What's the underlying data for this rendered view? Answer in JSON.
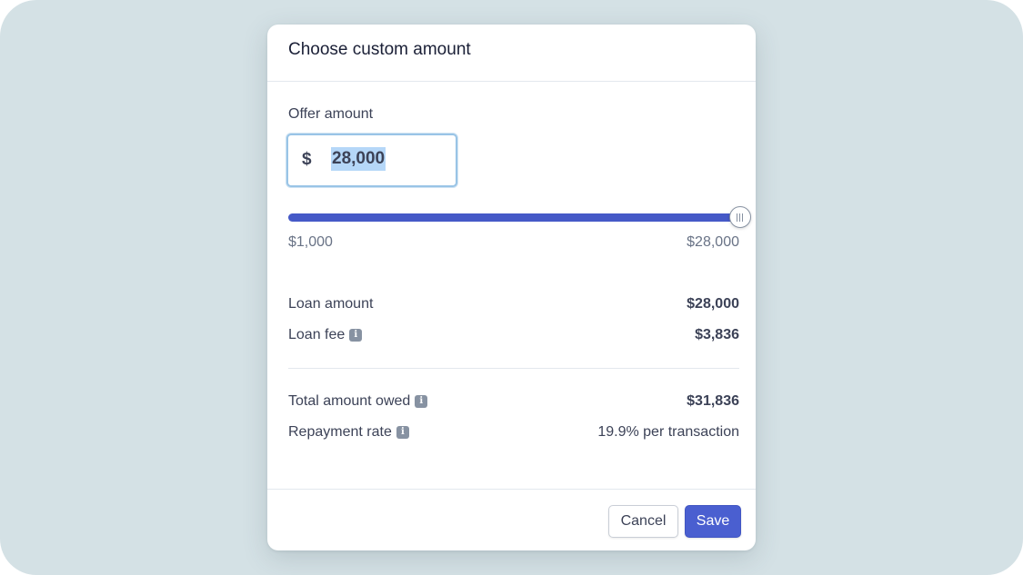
{
  "dialog": {
    "title": "Choose custom amount"
  },
  "offer": {
    "label": "Offer amount",
    "currency_symbol": "$",
    "value": "28,000"
  },
  "slider": {
    "min_label": "$1,000",
    "max_label": "$28,000",
    "fill_fraction": 1.0
  },
  "summary": {
    "loan_amount_label": "Loan amount",
    "loan_amount_value": "$28,000",
    "loan_fee_label": "Loan fee",
    "loan_fee_value": "$3,836",
    "total_owed_label": "Total amount owed",
    "total_owed_value": "$31,836",
    "repayment_rate_label": "Repayment rate",
    "repayment_rate_value": "19.9% per transaction"
  },
  "buttons": {
    "cancel_label": "Cancel",
    "save_label": "Save"
  },
  "icons": {
    "info": "info-icon",
    "slider_grip": "grip-icon"
  },
  "colors": {
    "accent": "#4a5fd0",
    "slider_fill": "#4559c7",
    "backdrop": "#d4e1e5",
    "selection": "#b5d7f8"
  }
}
